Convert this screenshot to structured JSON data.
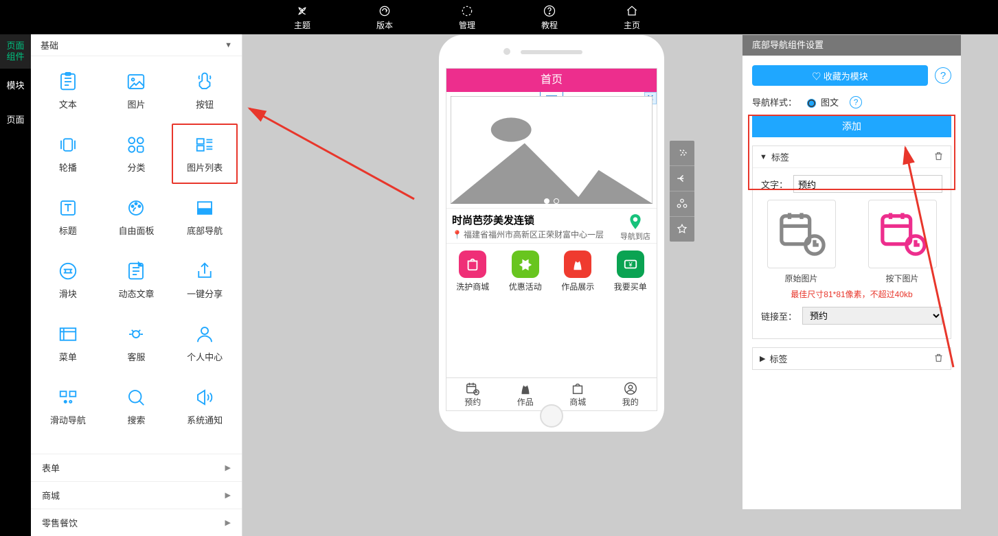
{
  "topbar": [
    {
      "label": "主题"
    },
    {
      "label": "版本"
    },
    {
      "label": "管理"
    },
    {
      "label": "教程"
    },
    {
      "label": "主页"
    }
  ],
  "leftnav": {
    "page_components": "页面\n组件",
    "module": "模块",
    "page": "页面"
  },
  "palette": {
    "header": "基础",
    "items": [
      {
        "label": "文本"
      },
      {
        "label": "图片"
      },
      {
        "label": "按钮"
      },
      {
        "label": "轮播"
      },
      {
        "label": "分类"
      },
      {
        "label": "图片列表"
      },
      {
        "label": "标题"
      },
      {
        "label": "自由面板"
      },
      {
        "label": "底部导航"
      },
      {
        "label": "滑块"
      },
      {
        "label": "动态文章"
      },
      {
        "label": "一键分享"
      },
      {
        "label": "菜单"
      },
      {
        "label": "客服"
      },
      {
        "label": "个人中心"
      },
      {
        "label": "滑动导航"
      },
      {
        "label": "搜索"
      },
      {
        "label": "系统通知"
      }
    ],
    "sections": [
      "表单",
      "商城",
      "零售餐饮"
    ]
  },
  "phone": {
    "title": "首页",
    "store_name": "时尚芭莎美发连锁",
    "store_addr": "福建省福州市高新区正荣财富中心一层",
    "store_nav": "导航到店",
    "quick": [
      "洗护商城",
      "优惠活动",
      "作品展示",
      "我要买单"
    ],
    "tabs": [
      "预约",
      "作品",
      "商城",
      "我的"
    ]
  },
  "panel": {
    "title": "底部导航组件设置",
    "fav": "♡ 收藏为模块",
    "nav_style_label": "导航样式：",
    "nav_style_opt": "图文",
    "add": "添加",
    "tag_header": "标签",
    "text_label": "文字：",
    "text_value": "预约",
    "img_orig": "原始图片",
    "img_press": "按下图片",
    "size_hint": "最佳尺寸81*81像素，不超过40kb",
    "link_label": "链接至：",
    "link_value": "预约",
    "collapsed_tag": "标签"
  }
}
